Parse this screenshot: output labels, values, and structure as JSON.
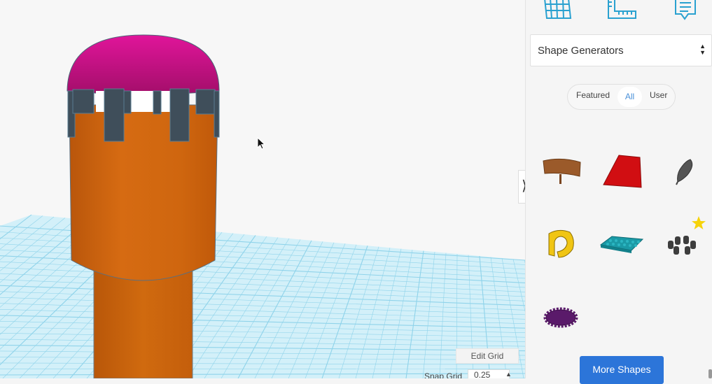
{
  "viewport": {
    "edit_grid_label": "Edit Grid",
    "snap_grid_label": "Snap Grid",
    "snap_grid_value": "0.25"
  },
  "panel": {
    "top_icons": [
      "grid-icon",
      "ruler-icon",
      "notes-icon"
    ],
    "category_select": "Shape Generators",
    "filter_tabs": [
      "Featured",
      "All",
      "User"
    ],
    "selected_filter": "All",
    "shapes": [
      "banner-shape",
      "red-wedge-shape",
      "gray-leaf-shape",
      "yellow-clip-shape",
      "teal-brick-plate-shape",
      "gray-ring-shape",
      "purple-gear-shape"
    ],
    "more_button": "More Shapes"
  },
  "colors": {
    "accent": "#2c75d9",
    "selected_filter": "#4a90d9",
    "dome": "#d6138b",
    "tower": "#d8690e",
    "battlement": "#3f4e5a",
    "grid": "#8fd3ea"
  }
}
